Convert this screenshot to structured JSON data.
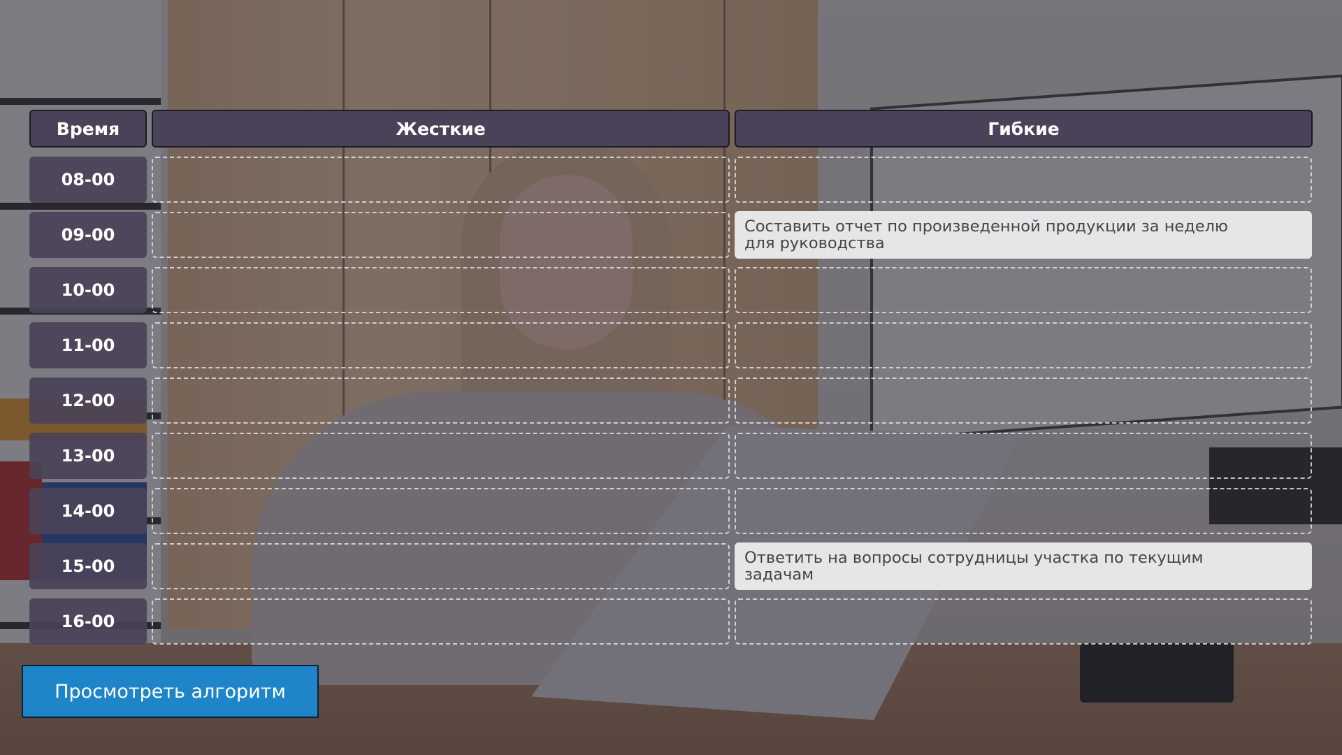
{
  "table": {
    "headers": {
      "time": "Время",
      "rigid": "Жесткие",
      "flexible": "Гибкие"
    },
    "times": [
      "08-00",
      "09-00",
      "10-00",
      "11-00",
      "12-00",
      "13-00",
      "14-00",
      "15-00",
      "16-00"
    ],
    "flexible_tasks": [
      {
        "time": "09-00",
        "text": "Составить отчет по произведенной продукции за неделю для руководства"
      },
      {
        "time": "15-00",
        "text": "Ответить на вопросы сотрудницы участка по текущим задачам"
      }
    ]
  },
  "actions": {
    "view_algorithm": "Просмотреть алгоритм"
  },
  "colors": {
    "header_bg": "#4a4258",
    "button_bg": "#1e86c8",
    "card_bg": "#e6e6e7"
  }
}
